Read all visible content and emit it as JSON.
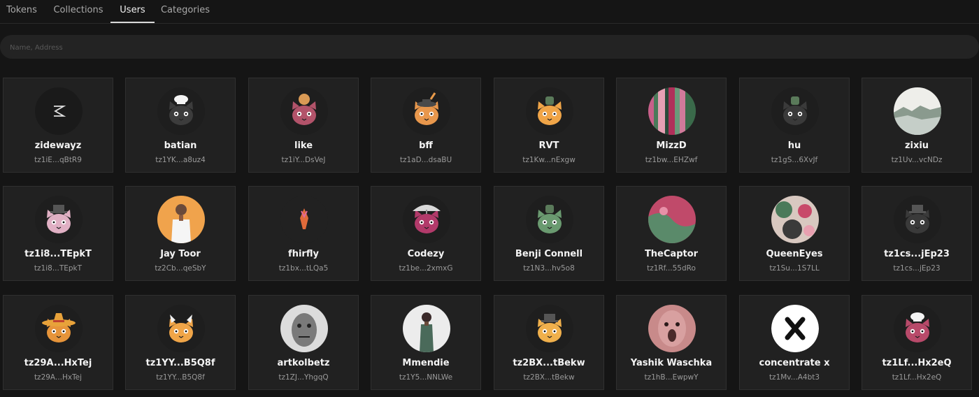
{
  "tabs": [
    {
      "label": "Tokens",
      "active": false
    },
    {
      "label": "Collections",
      "active": false
    },
    {
      "label": "Users",
      "active": true
    },
    {
      "label": "Categories",
      "active": false
    }
  ],
  "search": {
    "placeholder": "Name, Address",
    "value": ""
  },
  "users": [
    {
      "name": "zidewayz",
      "address": "tz1iE...qBtR9",
      "avatar": "zigzag-logo-icon"
    },
    {
      "name": "batian",
      "address": "tz1YK...a8uz4",
      "avatar": "cat-chef-hat-icon"
    },
    {
      "name": "like",
      "address": "tz1iY...DsVeJ",
      "avatar": "cat-bun-icon"
    },
    {
      "name": "bff",
      "address": "tz1aD...dsaBU",
      "avatar": "cat-feather-hat-icon"
    },
    {
      "name": "RVT",
      "address": "tz1Kw...nExgw",
      "avatar": "cat-orange-icon"
    },
    {
      "name": "MizzD",
      "address": "tz1bw...EHZwf",
      "avatar": "glitch-art-icon"
    },
    {
      "name": "hu",
      "address": "tz1gS...6XvJf",
      "avatar": "cat-dark-icon"
    },
    {
      "name": "zixiu",
      "address": "tz1Uv...vcNDz",
      "avatar": "landscape-art-icon"
    },
    {
      "name": "tz1i8...TEpkT",
      "address": "tz1i8...TEpkT",
      "avatar": "cat-pink-icon"
    },
    {
      "name": "Jay Toor",
      "address": "tz2Cb...qeSbY",
      "avatar": "portrait-photo-icon"
    },
    {
      "name": "fhirfly",
      "address": "tz1bx...tLQa5",
      "avatar": "flame-symbol-icon"
    },
    {
      "name": "Codezy",
      "address": "tz1be...2xmxG",
      "avatar": "cat-umbrella-icon"
    },
    {
      "name": "Benji Connell",
      "address": "tz1N3...hv5o8",
      "avatar": "cat-green-icon"
    },
    {
      "name": "TheCaptor",
      "address": "tz1Rf...55dRo",
      "avatar": "abstract-pink-icon"
    },
    {
      "name": "QueenEyes",
      "address": "tz1Su...1S7LL",
      "avatar": "abstract-pattern-icon"
    },
    {
      "name": "tz1cs...jEp23",
      "address": "tz1cs...jEp23",
      "avatar": "cat-dark-hat-icon"
    },
    {
      "name": "tz29A...HxTej",
      "address": "tz29A...HxTej",
      "avatar": "cat-sombrero-icon"
    },
    {
      "name": "tz1YY...B5Q8f",
      "address": "tz1YY...B5Q8f",
      "avatar": "cat-horns-icon"
    },
    {
      "name": "artkolbetz",
      "address": "tz1ZJ...YhgqQ",
      "avatar": "bw-face-art-icon"
    },
    {
      "name": "Mmendie",
      "address": "tz1Y5...NNLWe",
      "avatar": "figure-art-icon"
    },
    {
      "name": "tz2BX...tBekw",
      "address": "tz2BX...tBekw",
      "avatar": "cat-yellow-icon"
    },
    {
      "name": "Yashik Waschka",
      "address": "tz1hB...EwpwY",
      "avatar": "scream-face-art-icon"
    },
    {
      "name": "concentrate x",
      "address": "tz1Mv...A4bt3",
      "avatar": "x-logo-icon"
    },
    {
      "name": "tz1Lf...Hx2eQ",
      "address": "tz1Lf...Hx2eQ",
      "avatar": "cat-pink-chef-icon"
    }
  ]
}
